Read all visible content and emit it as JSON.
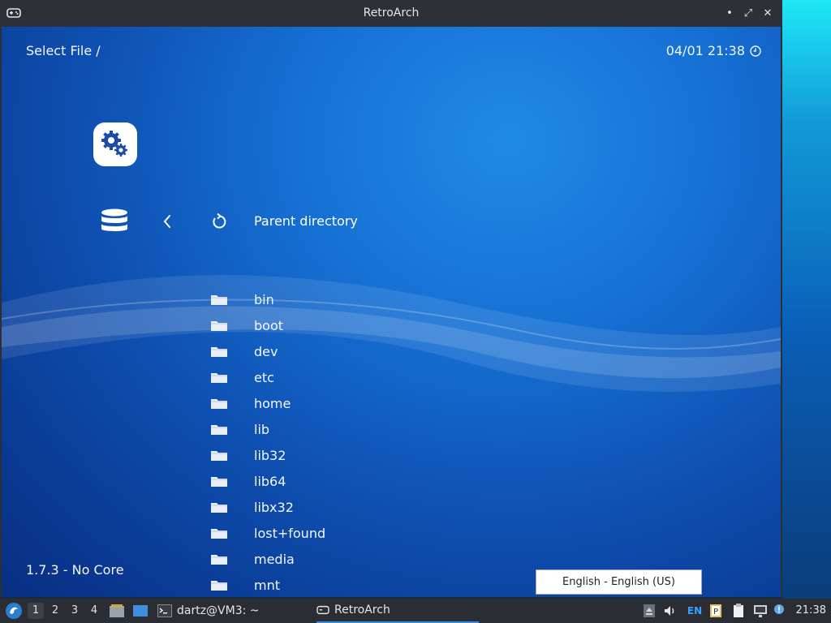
{
  "window": {
    "title": "RetroArch",
    "controls": {
      "minimize": "•",
      "maximize": "⤢",
      "close": "✕"
    }
  },
  "header": {
    "breadcrumb": "Select File /",
    "datetime": "04/01 21:38"
  },
  "menu": {
    "settings_icon": "gears-icon",
    "parent": "Parent directory"
  },
  "files": [
    {
      "name": "bin"
    },
    {
      "name": "boot"
    },
    {
      "name": "dev"
    },
    {
      "name": "etc"
    },
    {
      "name": "home"
    },
    {
      "name": "lib"
    },
    {
      "name": "lib32"
    },
    {
      "name": "lib64"
    },
    {
      "name": "libx32"
    },
    {
      "name": "lost+found"
    },
    {
      "name": "media"
    },
    {
      "name": "mnt"
    }
  ],
  "footer": {
    "version": "1.7.3 - No Core"
  },
  "tooltip": "English - English (US)",
  "taskbar": {
    "workspaces": [
      "1",
      "2",
      "3",
      "4"
    ],
    "active_workspace": "1",
    "tasks": [
      {
        "label": "dartz@VM3: ~"
      },
      {
        "label": "RetroArch"
      }
    ],
    "tray": {
      "keyboard": "EN"
    },
    "clock": "21:38"
  },
  "colors": {
    "accent": "#3a8ad8",
    "background_top": "#1f8ae6",
    "background_bottom": "#082f80"
  }
}
